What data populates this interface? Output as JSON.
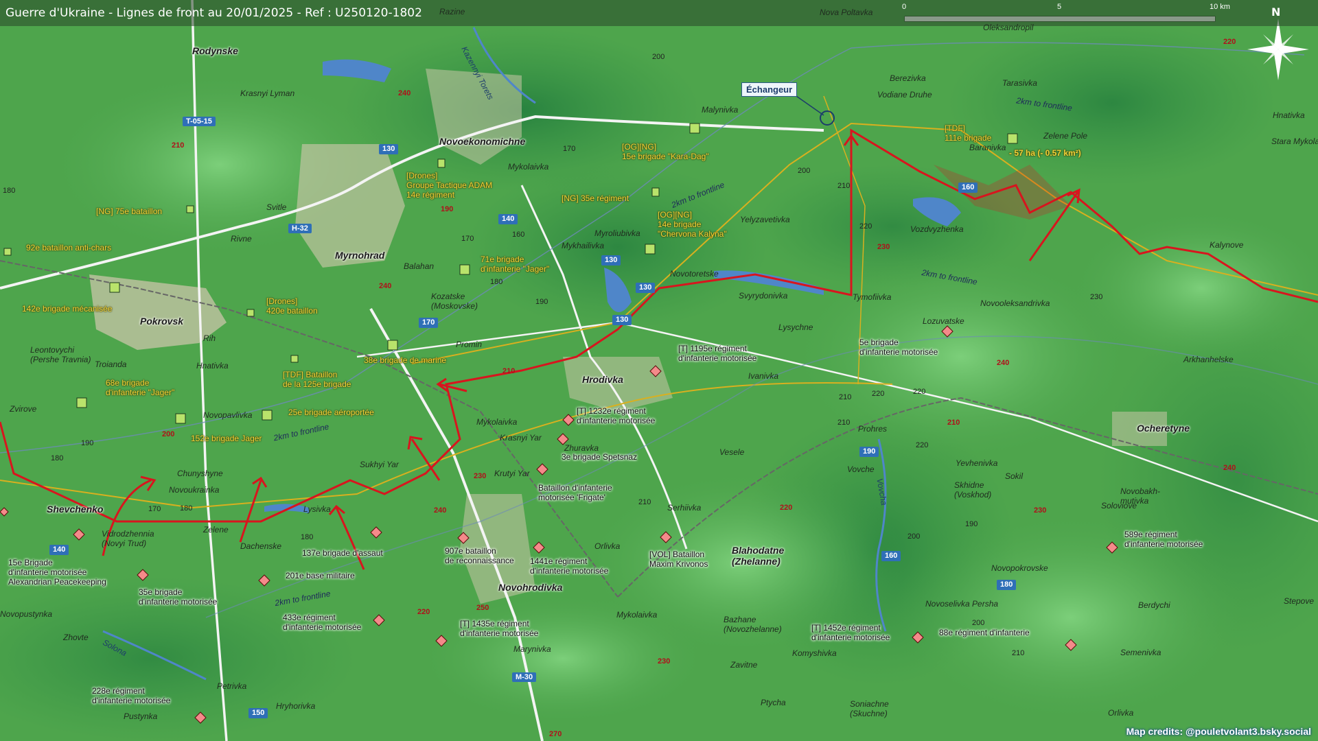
{
  "title": "Guerre d'Ukraine - Lignes de front au 20/01/2025 - Ref : U250120-1802",
  "scale": {
    "labels": [
      "0",
      "5",
      "10 km"
    ]
  },
  "north_label": "N",
  "credits": "Map credits: @pouletvolant3.bsky.social",
  "echangeur_label": "Échangeur",
  "gain_text": "- 57 ha (- 0.57 km²)",
  "colors": {
    "frontline": "#d8151e",
    "ua_text": "#f2d33a",
    "road_badge": "#2f6fb7",
    "water": "#4f86c9",
    "terrain": "#4aa24a"
  },
  "roads": [
    {
      "id": "t0515",
      "label": "T-05-15"
    },
    {
      "id": "h32",
      "label": "H-32"
    },
    {
      "id": "m30",
      "label": "M-30"
    }
  ],
  "towns": [
    {
      "id": "pokrovsk",
      "label": "Pokrovsk"
    },
    {
      "id": "myrnohrad",
      "label": "Myrnohrad"
    },
    {
      "id": "novoekonomichne",
      "label": "Novoekonomichne"
    },
    {
      "id": "hrodivka",
      "label": "Hrodivka"
    },
    {
      "id": "rodynske",
      "label": "Rodynske"
    },
    {
      "id": "shevchenko",
      "label": "Shevchenko"
    },
    {
      "id": "novohrodivka",
      "label": "Novohrodivka"
    },
    {
      "id": "ocheretyne",
      "label": "Ocheretyne"
    },
    {
      "id": "blahodatne",
      "label": "Blahodatne\n(Zhelanne)"
    }
  ],
  "places": [
    {
      "id": "p1",
      "label": "Razine"
    },
    {
      "id": "p2",
      "label": "Nova Poltavka"
    },
    {
      "id": "p3",
      "label": "Oleksandropil"
    },
    {
      "id": "p4",
      "label": "Krasnyi Lyman"
    },
    {
      "id": "p5",
      "label": "Malynivka"
    },
    {
      "id": "p6",
      "label": "Berezivka"
    },
    {
      "id": "p7",
      "label": "Vodiane Druhe"
    },
    {
      "id": "p8",
      "label": "Tarasivka"
    },
    {
      "id": "p9",
      "label": "Hnativka"
    },
    {
      "id": "p10",
      "label": "Stara Mykola"
    },
    {
      "id": "p11",
      "label": "Zelene Pole"
    },
    {
      "id": "p12",
      "label": "Baranivka"
    },
    {
      "id": "p13",
      "label": "Mykolaivka"
    },
    {
      "id": "p14",
      "label": "Svitle"
    },
    {
      "id": "p15",
      "label": "Rivne"
    },
    {
      "id": "p16",
      "label": "Myroliubivka"
    },
    {
      "id": "p17",
      "label": "Mykhailivka"
    },
    {
      "id": "p18",
      "label": "Yelyzavetivka"
    },
    {
      "id": "p19",
      "label": "Vozdvyzhenka"
    },
    {
      "id": "p20",
      "label": "Kalynove"
    },
    {
      "id": "p21",
      "label": "Balahan"
    },
    {
      "id": "p22",
      "label": "Novotoretske"
    },
    {
      "id": "p23",
      "label": "Svyrydonivka"
    },
    {
      "id": "p24",
      "label": "Tymofiivka"
    },
    {
      "id": "p25",
      "label": "Novooleksandrivka"
    },
    {
      "id": "p26",
      "label": "Kozatske\n(Moskovske)"
    },
    {
      "id": "p27",
      "label": "Lysychne"
    },
    {
      "id": "p28",
      "label": "Lozuvatske"
    },
    {
      "id": "p29",
      "label": "Rih"
    },
    {
      "id": "p30",
      "label": "Leontovychi\n(Pershe Travnia)"
    },
    {
      "id": "p31",
      "label": "Promin"
    },
    {
      "id": "p32",
      "label": "Troianda"
    },
    {
      "id": "p33",
      "label": "Hnativka"
    },
    {
      "id": "p34",
      "label": "Ivanivka"
    },
    {
      "id": "p35",
      "label": "Arkhanhelske"
    },
    {
      "id": "p36",
      "label": "Zvirove"
    },
    {
      "id": "p37",
      "label": "Novopavlivka"
    },
    {
      "id": "p38",
      "label": "Mykolaivka"
    },
    {
      "id": "p39",
      "label": "Krasnyi Yar"
    },
    {
      "id": "p40",
      "label": "Prohres"
    },
    {
      "id": "p41",
      "label": "Sukhyi Yar"
    },
    {
      "id": "p42",
      "label": "Krutyi Yar"
    },
    {
      "id": "p43",
      "label": "Zhuravka"
    },
    {
      "id": "p44",
      "label": "Vesele"
    },
    {
      "id": "p45",
      "label": "Chunyshyne"
    },
    {
      "id": "p46",
      "label": "Novoukrainka"
    },
    {
      "id": "p47",
      "label": "Vovche"
    },
    {
      "id": "p48",
      "label": "Yevhenivka"
    },
    {
      "id": "p49",
      "label": "Skhidne\n(Voskhod)"
    },
    {
      "id": "p50",
      "label": "Sokil"
    },
    {
      "id": "p51",
      "label": "Novobakh-\nmutivka"
    },
    {
      "id": "p52",
      "label": "Soloviove"
    },
    {
      "id": "p53",
      "label": "Lysivka"
    },
    {
      "id": "p54",
      "label": "Vidrodzhennia\n(Novyi Trud)"
    },
    {
      "id": "p55",
      "label": "Zelene"
    },
    {
      "id": "p56",
      "label": "Dachenske"
    },
    {
      "id": "p57",
      "label": "Serhiivka"
    },
    {
      "id": "p58",
      "label": "Orlivka"
    },
    {
      "id": "p59",
      "label": "Novopokrovske"
    },
    {
      "id": "p60",
      "label": "Novoselivka Persha"
    },
    {
      "id": "p61",
      "label": "Berdychi"
    },
    {
      "id": "p62",
      "label": "Stepove"
    },
    {
      "id": "p63",
      "label": "Mykolaivka"
    },
    {
      "id": "p64",
      "label": "Bazhane\n(Novozhelanne)"
    },
    {
      "id": "p65",
      "label": "Marynivka"
    },
    {
      "id": "p66",
      "label": "Komyshivka"
    },
    {
      "id": "p67",
      "label": "Semenivka"
    },
    {
      "id": "p68",
      "label": "Zhovte"
    },
    {
      "id": "p69",
      "label": "Zavitne"
    },
    {
      "id": "p70",
      "label": "Novopustynka"
    },
    {
      "id": "p71",
      "label": "Petrivka"
    },
    {
      "id": "p72",
      "label": "Hryhorivka"
    },
    {
      "id": "p73",
      "label": "Pustynka"
    },
    {
      "id": "p74",
      "label": "Ptycha"
    },
    {
      "id": "p75",
      "label": "Soniachne\n(Skuchne)"
    },
    {
      "id": "p76",
      "label": "Orlivka"
    },
    {
      "id": "p77",
      "label": "Kazennyi Torets"
    },
    {
      "id": "p78",
      "label": "Vovcha"
    },
    {
      "id": "p79",
      "label": "Solona"
    }
  ],
  "ua_units": [
    {
      "id": "u1",
      "label": "[NG] 75e bataillon"
    },
    {
      "id": "u2",
      "label": "92e bataillon anti-chars"
    },
    {
      "id": "u3",
      "label": "142e brigade mécanisée"
    },
    {
      "id": "u4",
      "label": "[Drones]\n420e bataillon"
    },
    {
      "id": "u5",
      "label": "[Drones]\nGroupe Tactique ADAM\n14e régiment"
    },
    {
      "id": "u6",
      "label": "[OG][NG]\n15e brigade \"Kara-Dag\""
    },
    {
      "id": "u7",
      "label": "[NG] 35e régiment"
    },
    {
      "id": "u8",
      "label": "[OG][NG]\n14e brigade\n\"Chervona Kalyna\""
    },
    {
      "id": "u9",
      "label": "71e brigade\nd'infanterie \"Jager\""
    },
    {
      "id": "u10",
      "label": "38e brigade de marine"
    },
    {
      "id": "u11",
      "label": "[TDF] Bataillon\nde la 125e brigade"
    },
    {
      "id": "u12",
      "label": "68e brigade\nd'infanterie \"Jager\""
    },
    {
      "id": "u13",
      "label": "25e brigade aéroportée"
    },
    {
      "id": "u14",
      "label": "152e brigade Jager"
    },
    {
      "id": "u15",
      "label": "[TDF]\n111e brigade"
    }
  ],
  "ru_units": [
    {
      "id": "r1",
      "label": "[T] 1195e régiment\nd'infanterie motorisée"
    },
    {
      "id": "r2",
      "label": "5e brigade\nd'infanterie motorisée"
    },
    {
      "id": "r3",
      "label": "[T] 1232e régiment\nd'infanterie motorisée"
    },
    {
      "id": "r4",
      "label": "3e brigade Spetsnaz"
    },
    {
      "id": "r5",
      "label": "Bataillon d'infanterie\nmotorisée 'Frigate'"
    },
    {
      "id": "r6",
      "label": "[VOL] Bataillon\nMaxim Krivonos"
    },
    {
      "id": "r7",
      "label": "907e bataillon\nde reconnaissance"
    },
    {
      "id": "r8",
      "label": "1441e régiment\nd'infanterie motorisée"
    },
    {
      "id": "r9",
      "label": "137e brigade d'assaut"
    },
    {
      "id": "r10",
      "label": "201e base militaire"
    },
    {
      "id": "r11",
      "label": "15e Brigade\nd'infanterie motorisée\nAlexandrian Peacekeeping"
    },
    {
      "id": "r12",
      "label": "35e brigade\nd'infanterie motorisée"
    },
    {
      "id": "r13",
      "label": "433e régiment\nd'infanterie motorisée"
    },
    {
      "id": "r14",
      "label": "[T] 1435e régiment\nd'infanterie motorisée"
    },
    {
      "id": "r15",
      "label": "[T] 1452e régiment\nd'infanterie motorisée"
    },
    {
      "id": "r16",
      "label": "88e régiment d'infanterie"
    },
    {
      "id": "r17",
      "label": "589e régiment\nd'infanterie motorisée"
    },
    {
      "id": "r18",
      "label": "228e régiment\nd'infanterie motorisée"
    }
  ],
  "front_2km": [
    {
      "id": "f1",
      "label": "2km to frontline"
    },
    {
      "id": "f2",
      "label": "2km to frontline"
    },
    {
      "id": "f3",
      "label": "2km to frontline"
    },
    {
      "id": "f4",
      "label": "2km to frontline"
    },
    {
      "id": "f5",
      "label": "2km to frontline"
    }
  ],
  "elevations_black": [
    {
      "id": "e1",
      "label": "200"
    },
    {
      "id": "e2",
      "label": "170"
    },
    {
      "id": "e3",
      "label": "200"
    },
    {
      "id": "e4",
      "label": "180"
    },
    {
      "id": "e5",
      "label": "160"
    },
    {
      "id": "e6",
      "label": "170"
    },
    {
      "id": "e7",
      "label": "180"
    },
    {
      "id": "e8",
      "label": "190"
    },
    {
      "id": "e9",
      "label": "210"
    },
    {
      "id": "e10",
      "label": "220"
    },
    {
      "id": "e11",
      "label": "230"
    },
    {
      "id": "e12",
      "label": "220"
    },
    {
      "id": "e13",
      "label": "220"
    },
    {
      "id": "e14",
      "label": "210"
    },
    {
      "id": "e15",
      "label": "220"
    },
    {
      "id": "e16",
      "label": "190"
    },
    {
      "id": "e17",
      "label": "180"
    },
    {
      "id": "e18",
      "label": "170"
    },
    {
      "id": "e19",
      "label": "180"
    },
    {
      "id": "e20",
      "label": "180"
    },
    {
      "id": "e21",
      "label": "210"
    },
    {
      "id": "e22",
      "label": "200"
    },
    {
      "id": "e23",
      "label": "190"
    },
    {
      "id": "e24",
      "label": "210"
    },
    {
      "id": "e25",
      "label": "200"
    },
    {
      "id": "e26",
      "label": "210"
    },
    {
      "id": "e27",
      "label": "180"
    }
  ],
  "elevations_red": [
    {
      "id": "er1",
      "label": "240"
    },
    {
      "id": "er2",
      "label": "210"
    },
    {
      "id": "er3",
      "label": "190"
    },
    {
      "id": "er4",
      "label": "240"
    },
    {
      "id": "er5",
      "label": "210"
    },
    {
      "id": "er6",
      "label": "230"
    },
    {
      "id": "er7",
      "label": "220"
    },
    {
      "id": "er8",
      "label": "200"
    },
    {
      "id": "er9",
      "label": "210"
    },
    {
      "id": "er10",
      "label": "240"
    },
    {
      "id": "er11",
      "label": "210"
    },
    {
      "id": "er12",
      "label": "230"
    },
    {
      "id": "er13",
      "label": "240"
    },
    {
      "id": "er14",
      "label": "220"
    },
    {
      "id": "er15",
      "label": "230"
    },
    {
      "id": "er16",
      "label": "250"
    },
    {
      "id": "er17",
      "label": "220"
    },
    {
      "id": "er18",
      "label": "230"
    },
    {
      "id": "er19",
      "label": "240"
    },
    {
      "id": "er20",
      "label": "270"
    },
    {
      "id": "er21",
      "label": "220"
    }
  ],
  "road_numbers": [
    {
      "id": "rn1",
      "label": "130"
    },
    {
      "id": "rn2",
      "label": "140"
    },
    {
      "id": "rn3",
      "label": "130"
    },
    {
      "id": "rn4",
      "label": "130"
    },
    {
      "id": "rn5",
      "label": "130"
    },
    {
      "id": "rn6",
      "label": "170"
    },
    {
      "id": "rn7",
      "label": "160"
    },
    {
      "id": "rn8",
      "label": "190"
    },
    {
      "id": "rn9",
      "label": "160"
    },
    {
      "id": "rn10",
      "label": "180"
    },
    {
      "id": "rn11",
      "label": "140"
    },
    {
      "id": "rn12",
      "label": "150"
    }
  ]
}
